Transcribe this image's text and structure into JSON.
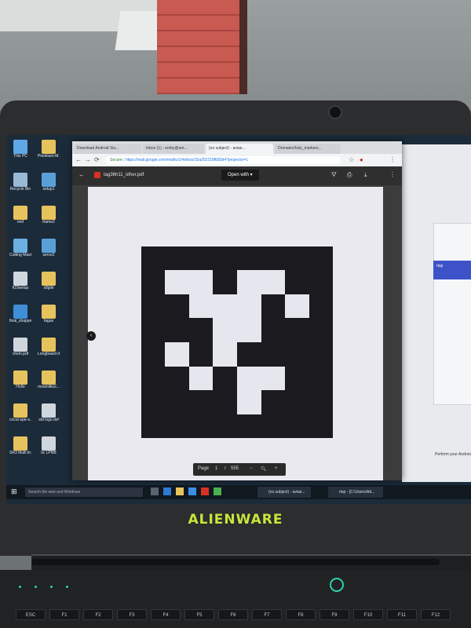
{
  "colors": {
    "accent": "#c8e63a",
    "marker_black": "#1b1b1f",
    "marker_white": "#e6e6ee",
    "led": "#2ed3b0"
  },
  "desktop": {
    "icons": [
      {
        "label": "This PC",
        "icon": "pc-icon",
        "color": "#5fa8e8"
      },
      {
        "label": "Recycle Bin",
        "icon": "recycle-bin-icon",
        "color": "#9bb8d6"
      },
      {
        "label": "msf",
        "icon": "folder-icon",
        "color": "#e6c35c"
      },
      {
        "label": "Cutting Master 4 1.80",
        "icon": "app-icon",
        "color": "#6ab0e0"
      },
      {
        "label": "ft19setup",
        "icon": "file-icon",
        "color": "#cfd6de"
      },
      {
        "label": "final_shapper",
        "icon": "file-icon",
        "color": "#3f8fd8"
      },
      {
        "label": "chsm.pdf",
        "icon": "pdf-icon",
        "color": "#d0d6dc"
      },
      {
        "label": "Hollo",
        "icon": "folder-icon",
        "color": "#e6c35c"
      },
      {
        "label": "cricut-spe-s...",
        "icon": "file-icon",
        "color": "#e6c35c"
      },
      {
        "label": "SR3 Multi license 2013",
        "icon": "folder-icon",
        "color": "#e6c35c"
      }
    ],
    "icons_col2": [
      {
        "label": "Pinokium-M...",
        "icon": "folder-icon",
        "color": "#e6c35c"
      },
      {
        "label": "setup1",
        "icon": "setup-icon",
        "color": "#5aa0d8"
      },
      {
        "label": "frame2",
        "icon": "folder-icon",
        "color": "#e6c35c"
      },
      {
        "label": "servo2",
        "icon": "setup-icon",
        "color": "#5aa0d8"
      },
      {
        "label": "x8gile",
        "icon": "folder-icon",
        "color": "#e6c35c"
      },
      {
        "label": "fagas",
        "icon": "folder-icon",
        "color": "#e6c35c"
      },
      {
        "label": "Longboard deck 2018",
        "icon": "folder-icon",
        "color": "#e6c35c"
      },
      {
        "label": "mosmilks2...",
        "icon": "folder-icon",
        "color": "#e6c35c"
      },
      {
        "label": "std logo.dxf",
        "icon": "file-icon",
        "color": "#cfd6de"
      },
      {
        "label": "tic LPNB",
        "icon": "file-icon",
        "color": "#cfd6de"
      }
    ]
  },
  "browser": {
    "tabs": [
      "Download Android Stu...",
      "Inbox (1) - emby@am...",
      "(no subject) - aviae...",
      "Dronatec/holy_markers..."
    ],
    "url_security": "Secure",
    "url": "https://mail.google.com/mail/u/1/#inbox/15a252218f683d4?projector=1"
  },
  "viewer": {
    "filename": "tag36h11_other.pdf",
    "open_with": "Open with",
    "page_label": "Page",
    "page_current": "1",
    "page_separator": "/",
    "page_total": "555",
    "zoom_out": "−",
    "zoom_in": "+",
    "prev_arrow": "‹"
  },
  "bg_app": {
    "blue_text": "rtsp",
    "footer_text": "Perform your Android Studio"
  },
  "taskbar": {
    "search": "Search the web and Windows",
    "tasks": [
      "(no subject) - aviae...",
      "rtsp - [C:\\Users\\Ad..."
    ]
  },
  "brand": {
    "name": "ALIENWARE"
  },
  "keyboard": {
    "keys": [
      "ESC",
      "F1",
      "F2",
      "F3",
      "F4",
      "F5",
      "F6",
      "F7",
      "F8",
      "F9",
      "F10",
      "F11",
      "F12"
    ]
  },
  "marker_grid": [
    [
      0,
      0,
      0,
      0,
      0,
      0,
      0,
      0
    ],
    [
      0,
      1,
      1,
      0,
      1,
      1,
      0,
      0
    ],
    [
      0,
      0,
      1,
      1,
      1,
      0,
      1,
      0
    ],
    [
      0,
      0,
      0,
      1,
      1,
      0,
      0,
      0
    ],
    [
      0,
      1,
      0,
      1,
      0,
      0,
      0,
      0
    ],
    [
      0,
      0,
      1,
      0,
      1,
      1,
      0,
      0
    ],
    [
      0,
      0,
      0,
      0,
      1,
      0,
      0,
      0
    ],
    [
      0,
      0,
      0,
      0,
      0,
      0,
      0,
      0
    ]
  ]
}
